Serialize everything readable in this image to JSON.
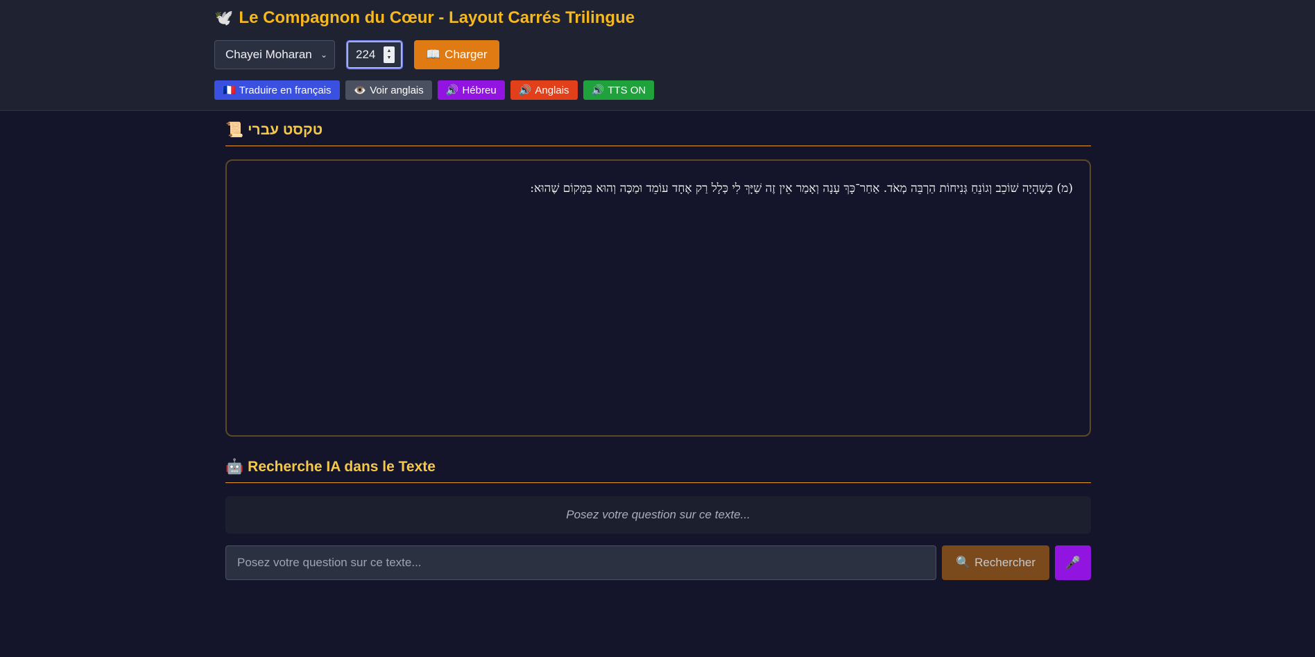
{
  "header": {
    "title_icon": "🕊️",
    "title": "Le Compagnon du Cœur - Layout Carrés Trilingue",
    "book_select": {
      "selected": "Chayei Moharan"
    },
    "page_number": "224",
    "load_button": {
      "icon": "📖",
      "label": "Charger"
    },
    "actions": [
      {
        "icon": "🇫🇷",
        "label": "Traduire en français",
        "color": "#3a50e0"
      },
      {
        "icon": "👁️",
        "label": "Voir anglais",
        "color": "#4b5060"
      },
      {
        "icon": "🔊",
        "label": "Hébreu",
        "color": "#9214e0"
      },
      {
        "icon": "🔊",
        "label": "Anglais",
        "color": "#e2401a"
      },
      {
        "icon": "🔊",
        "label": "TTS ON",
        "color": "#1fa23c"
      }
    ]
  },
  "hebrew_section": {
    "icon": "📜",
    "heading": "טקסט עברי",
    "text": "(מ) כְּשֶׁהָיָה שׁוֹכֵב וְגוֹנֵחַ גְּנִיחוֹת הַרְבֵּה מְאֹד. אַחַר־כָּךְ עָנָה וְאָמַר אֵין זֶה שַׁיָּךְ לִי כְּלָל רַק אֶחָד עוֹמֵד וּמַכֶּה וְהוּא בַּמָּקוֹם שֶׁהוּא:"
  },
  "ai_section": {
    "icon": "🤖",
    "heading": "Recherche IA dans le Texte",
    "answer_placeholder": "Posez votre question sur ce texte...",
    "input_placeholder": "Posez votre question sur ce texte...",
    "search_button": {
      "icon": "🔍",
      "label": "Rechercher"
    },
    "mic_icon": "🎤"
  },
  "colors": {
    "accent": "#f5b820",
    "background": "#14152a",
    "header_bg": "#1e2231"
  }
}
